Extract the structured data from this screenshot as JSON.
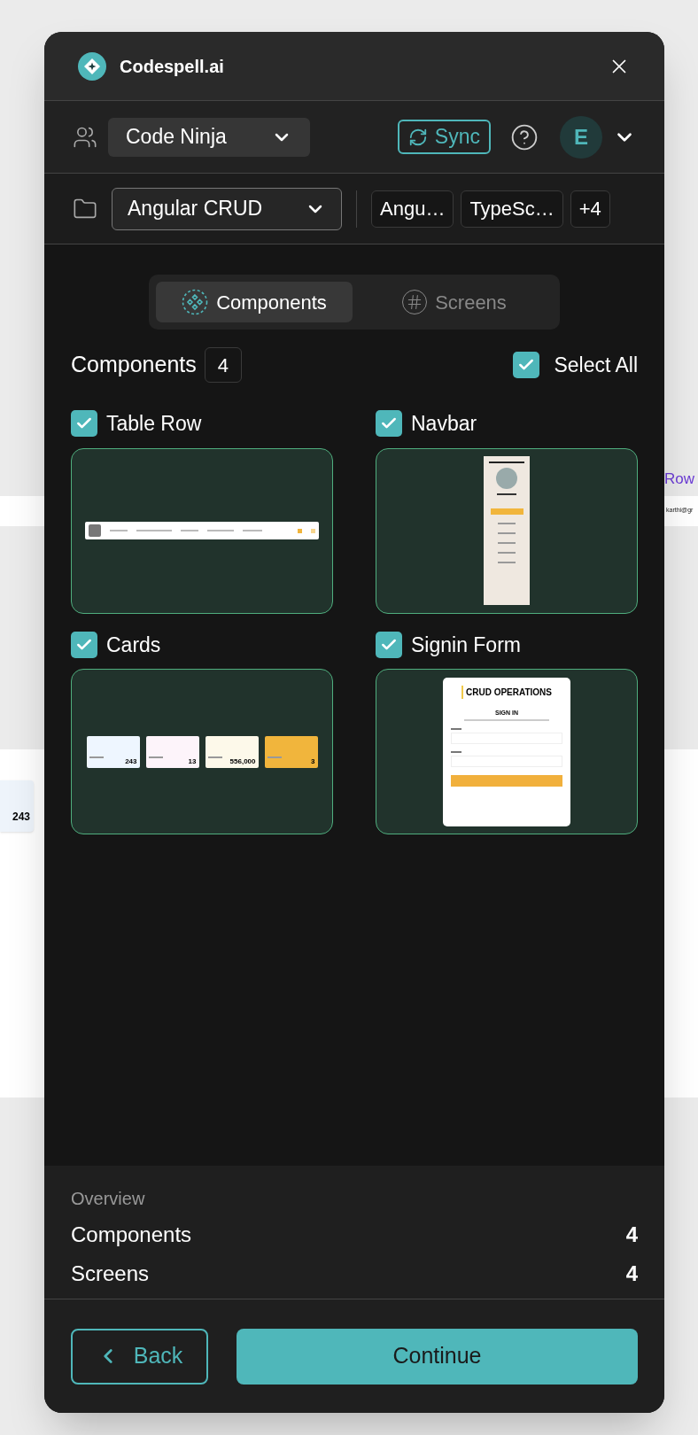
{
  "background_page": {
    "heading_fragment": "Row",
    "row_text": "karthi@gr",
    "stat_value": "243"
  },
  "window": {
    "title": "Codespell.ai"
  },
  "toolbar": {
    "team": "Code Ninja",
    "sync": "Sync",
    "avatar_initial": "E"
  },
  "project": {
    "name": "Angular CRUD",
    "tags": [
      "Angu…",
      "TypeSc…",
      "+4"
    ]
  },
  "tabs": [
    {
      "label": "Components",
      "selected": true
    },
    {
      "label": "Screens",
      "selected": false
    }
  ],
  "section": {
    "title": "Components",
    "count": "4",
    "select_all": {
      "label": "Select All",
      "checked": true
    }
  },
  "items": [
    {
      "kind": "table_row",
      "label": "Table Row",
      "checked": true
    },
    {
      "kind": "navbar",
      "label": "Navbar",
      "checked": true
    },
    {
      "kind": "cards",
      "label": "Cards",
      "checked": true,
      "cards": [
        {
          "value": "243",
          "color": "#eef6ff"
        },
        {
          "value": "13",
          "color": "#fdf4fa"
        },
        {
          "value": "556,000",
          "color": "#fdf9ea"
        },
        {
          "value": "3",
          "color": "#f1b53c"
        }
      ]
    },
    {
      "kind": "signin",
      "label": "Signin Form",
      "checked": true,
      "title": "CRUD OPERATIONS",
      "heading": "SIGN IN"
    }
  ],
  "overview": {
    "title": "Overview",
    "rows": [
      {
        "label": "Components",
        "value": "4"
      },
      {
        "label": "Screens",
        "value": "4"
      }
    ]
  },
  "buttons": {
    "back": "Back",
    "continue": "Continue"
  }
}
